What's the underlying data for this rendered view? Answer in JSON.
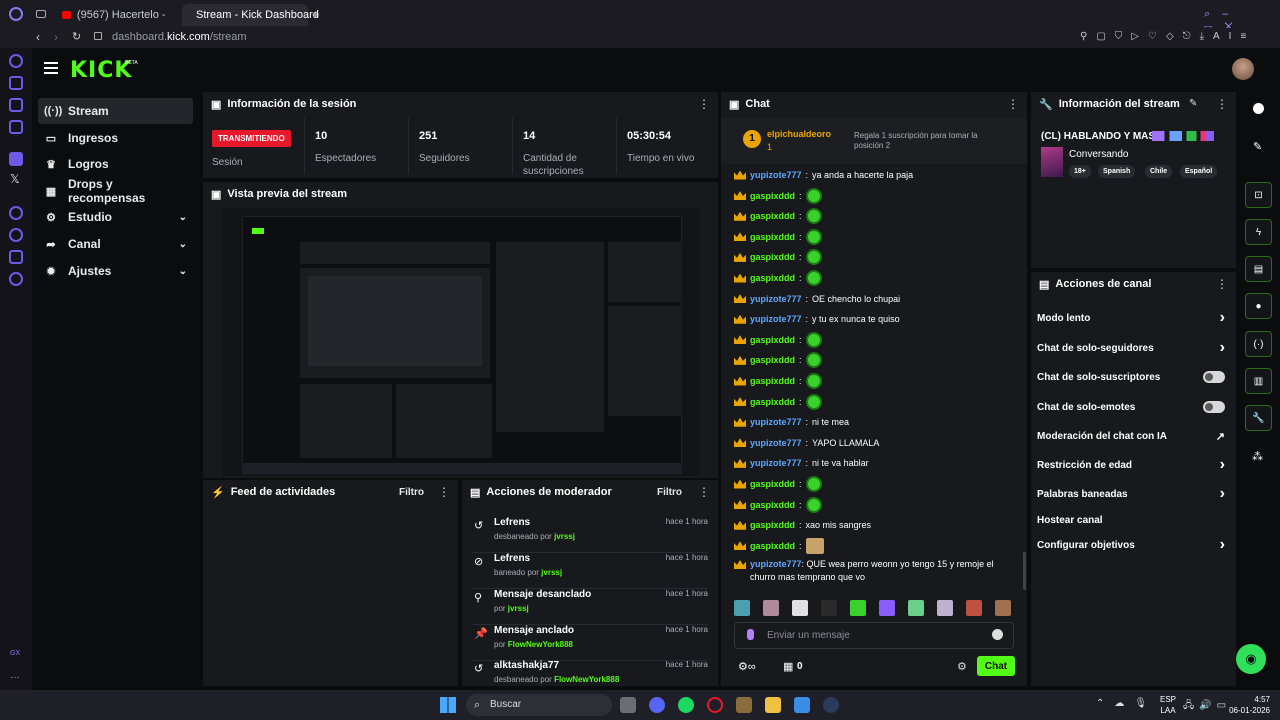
{
  "browser": {
    "tabs": [
      {
        "label": "(9567) Hacerlelo - YouTube",
        "display": "(9567) Hacertelo - YouTu"
      },
      {
        "label": "Stream - Kick Dashboard"
      }
    ],
    "new_tab": "+",
    "url_prefix": "dashboard.",
    "url_domain": "kick.com",
    "url_path": "/stream",
    "ai_label": "AI"
  },
  "app": {
    "logo": "KICK",
    "beta": "BETA",
    "nav": [
      {
        "label": "Stream",
        "icon": "stream-icon"
      },
      {
        "label": "Ingresos",
        "icon": "money-icon"
      },
      {
        "label": "Logros",
        "icon": "trophy-icon"
      },
      {
        "label": "Drops y recompensas",
        "icon": "drops-icon"
      },
      {
        "label": "Estudio",
        "icon": "studio-icon"
      },
      {
        "label": "Canal",
        "icon": "channel-icon"
      },
      {
        "label": "Ajustes",
        "icon": "settings-icon"
      }
    ]
  },
  "session": {
    "title": "Información de la sesión",
    "status": "TRANSMITIENDO",
    "status_label": "Sesión",
    "stats": [
      {
        "value": "10",
        "label": "Espectadores"
      },
      {
        "value": "251",
        "label": "Seguidores"
      },
      {
        "value": "14",
        "label": "Cantidad de",
        "label2": "suscripciones"
      },
      {
        "value": "05:30:54",
        "label": "Tiempo en vivo"
      }
    ]
  },
  "preview": {
    "title": "Vista previa del stream"
  },
  "activity": {
    "title": "Feed de actividades",
    "filter": "Filtro"
  },
  "modactions": {
    "title": "Acciones de moderador",
    "filter": "Filtro",
    "items": [
      {
        "title": "Lefrens",
        "sub": "desbaneado por",
        "user": "jvrssj",
        "time": "hace 1 hora",
        "icon": "undo-icon"
      },
      {
        "title": "Lefrens",
        "sub": "baneado por",
        "user": "jvrssj",
        "time": "hace 1 hora",
        "icon": "ban-icon"
      },
      {
        "title": "Mensaje desanclado",
        "sub": "por",
        "user": "jvrssj",
        "time": "hace 1 hora",
        "icon": "unpin-icon"
      },
      {
        "title": "Mensaje anclado",
        "sub": "por",
        "user": "FlowNewYork888",
        "time": "hace 1 hora",
        "icon": "pin-icon"
      },
      {
        "title": "alktashakja77",
        "sub": "desbaneado por",
        "user": "FlowNewYork888",
        "time": "hace 1 hora",
        "icon": "undo-icon"
      }
    ]
  },
  "chat": {
    "title": "Chat",
    "pinned_rank": "1",
    "pinned_user": "elpichualdeoro",
    "pinned_sub": "1",
    "gift_text": "Regala 1 suscripción para tomar la posición 2",
    "messages": [
      {
        "user": "yupizote777",
        "text": "ya anda a hacerte la paja",
        "color": "y"
      },
      {
        "user": "gaspixddd",
        "text": "",
        "emote": true,
        "color": "g"
      },
      {
        "user": "gaspixddd",
        "text": "",
        "emote": true,
        "color": "g"
      },
      {
        "user": "gaspixddd",
        "text": "",
        "emote": true,
        "color": "g"
      },
      {
        "user": "gaspixddd",
        "text": "",
        "emote": true,
        "color": "g"
      },
      {
        "user": "gaspixddd",
        "text": "",
        "emote": true,
        "color": "g"
      },
      {
        "user": "yupizote777",
        "text": "OE chencho lo chupai",
        "color": "y"
      },
      {
        "user": "yupizote777",
        "text": "y tu ex nunca te quiso",
        "color": "y"
      },
      {
        "user": "gaspixddd",
        "text": "",
        "emote": true,
        "color": "g"
      },
      {
        "user": "gaspixddd",
        "text": "",
        "emote": true,
        "color": "g"
      },
      {
        "user": "gaspixddd",
        "text": "",
        "emote": true,
        "color": "g"
      },
      {
        "user": "gaspixddd",
        "text": "",
        "emote": true,
        "color": "g"
      },
      {
        "user": "yupizote777",
        "text": "ni te mea",
        "color": "y"
      },
      {
        "user": "yupizote777",
        "text": "YAPO LLAMALA",
        "color": "y"
      },
      {
        "user": "yupizote777",
        "text": "ni te va hablar",
        "color": "y"
      },
      {
        "user": "gaspixddd",
        "text": "",
        "emote": true,
        "color": "g"
      },
      {
        "user": "gaspixddd",
        "text": "",
        "emote": true,
        "color": "g"
      },
      {
        "user": "gaspixddd",
        "text": "xao mis sangres",
        "color": "g"
      },
      {
        "user": "gaspixddd",
        "text": "",
        "emote2": true,
        "color": "g"
      }
    ],
    "last_user": "yupizote777",
    "last_text1": "QUE wea perro weonn yo tengo 15 y remoje el",
    "last_text2": "churro mas temprano que vo",
    "input_placeholder": "Enviar un mensaje",
    "points": "0",
    "send": "Chat"
  },
  "streaminfo": {
    "title": "Información del stream",
    "stream_title": "(CL) HABLANDO Y MAS",
    "category": "Conversando",
    "tags": [
      "18+",
      "Spanish",
      "Chile",
      "Español"
    ]
  },
  "channel": {
    "title": "Acciones de canal",
    "actions": [
      {
        "label": "Modo lento",
        "kind": "chevron"
      },
      {
        "label": "Chat de solo-seguidores",
        "kind": "chevron"
      },
      {
        "label": "Chat de solo-suscriptores",
        "kind": "toggle"
      },
      {
        "label": "Chat de solo-emotes",
        "kind": "toggle"
      },
      {
        "label": "Moderación del chat con IA",
        "kind": "external"
      },
      {
        "label": "Restricción de edad",
        "kind": "chevron"
      },
      {
        "label": "Palabras baneadas",
        "kind": "chevron"
      },
      {
        "label": "Hostear canal",
        "kind": "none"
      },
      {
        "label": "Configurar objetivos",
        "kind": "chevron"
      }
    ]
  },
  "taskbar": {
    "search": "Buscar",
    "lang1": "ESP",
    "lang2": "LAA",
    "time": "4:57",
    "date": "06-01-2026"
  },
  "sidebar_gx": "GX",
  "colors": {
    "accent": "#53fc18",
    "live": "#e8182c",
    "opera": "#6d5ae6"
  }
}
